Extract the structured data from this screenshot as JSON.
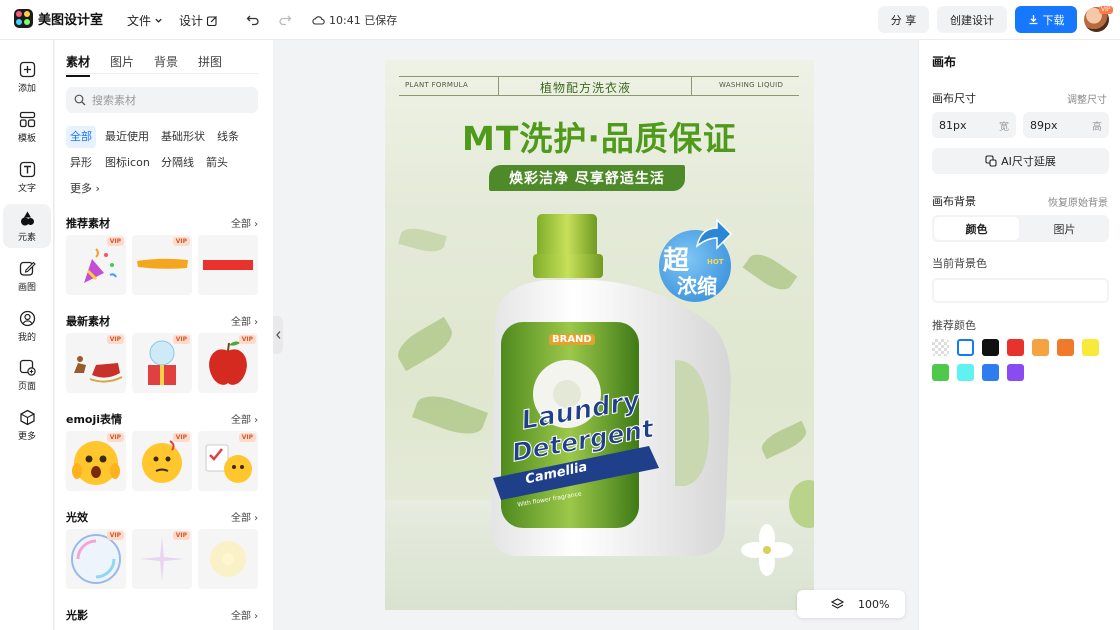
{
  "app": {
    "name": "美图设计室"
  },
  "menu": {
    "file": "文件",
    "design": "设计"
  },
  "save_status": "10:41 已保存",
  "actions": {
    "share": "分 享",
    "create": "创建设计",
    "download": "下载"
  },
  "rail": [
    {
      "label": "添加",
      "icon": "plus-icon"
    },
    {
      "label": "模板",
      "icon": "template-icon"
    },
    {
      "label": "文字",
      "icon": "text-icon"
    },
    {
      "label": "元素",
      "icon": "element-icon"
    },
    {
      "label": "画图",
      "icon": "draw-icon"
    },
    {
      "label": "我的",
      "icon": "user-icon"
    },
    {
      "label": "页面",
      "icon": "page-icon"
    },
    {
      "label": "更多",
      "icon": "more-icon"
    }
  ],
  "panel": {
    "tabs": [
      "素材",
      "图片",
      "背景",
      "拼图"
    ],
    "search_placeholder": "搜索素材",
    "chips": [
      "全部",
      "最近使用",
      "基础形状",
      "线条",
      "异形",
      "图标icon",
      "分隔线",
      "箭头",
      "更多"
    ],
    "all_label": "全部",
    "vip_label": "VIP",
    "sections": [
      "推荐素材",
      "最新素材",
      "emoji表情",
      "光效",
      "光影"
    ]
  },
  "poster": {
    "top_left": "PLANT FORMULA",
    "top_center": "植物配方洗衣液",
    "top_right": "WASHING LIQUID",
    "headline": "MT洗护·品质保证",
    "ribbon": "焕彩洁净 尽享舒适生活",
    "badge_line1": "超",
    "badge_line2": "浓缩",
    "badge_hot": "HOT",
    "brand": "BRAND",
    "label_line1": "Laundry",
    "label_line2": "Detergent",
    "label_line3": "Camellia",
    "label_small": "With flower fragrance"
  },
  "zoom": "100%",
  "right": {
    "title": "画布",
    "size_label": "画布尺寸",
    "resize_link": "调整尺寸",
    "width_value": "81px",
    "width_unit": "宽",
    "height_value": "89px",
    "height_unit": "高",
    "ai_extend": "AI尺寸延展",
    "bg_label": "画布背景",
    "restore_link": "恢复原始背景",
    "bg_tabs": [
      "颜色",
      "图片"
    ],
    "current_bg_label": "当前背景色",
    "recommend_label": "推荐颜色",
    "swatches": [
      "transparent",
      "#ffffff",
      "#111111",
      "#e8322b",
      "#f4a340",
      "#f07a2a",
      "#f7ea3a",
      "#4ec94a",
      "#5ff2ef",
      "#2d7cf0",
      "#8a4bf0"
    ]
  }
}
